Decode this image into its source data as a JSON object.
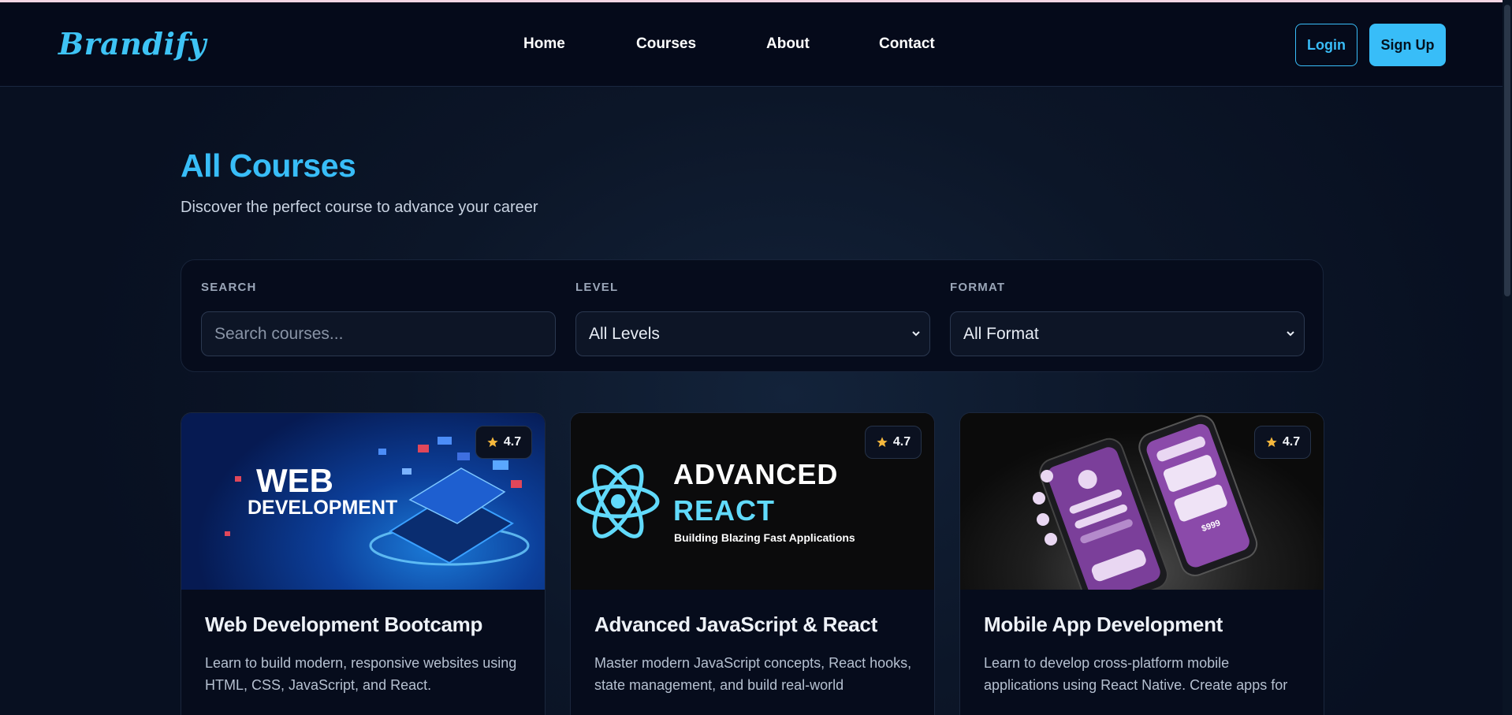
{
  "brand": {
    "logo_text": "Brandify",
    "accent": "#38bdf8"
  },
  "nav": {
    "items": [
      "Home",
      "Courses",
      "About",
      "Contact"
    ]
  },
  "auth": {
    "login_label": "Login",
    "signup_label": "Sign Up"
  },
  "page": {
    "title": "All Courses",
    "subtitle": "Discover the perfect course to advance your career"
  },
  "filters": {
    "search": {
      "label": "SEARCH",
      "placeholder": "Search courses...",
      "value": ""
    },
    "level": {
      "label": "LEVEL",
      "selected": "All Levels"
    },
    "format": {
      "label": "FORMAT",
      "selected": "All Format"
    }
  },
  "courses": [
    {
      "title": "Web Development Bootcamp",
      "description": "Learn to build modern, responsive websites using HTML, CSS, JavaScript, and React.",
      "rating": "4.7",
      "thumb": {
        "line1": "WEB",
        "line2": "DEVELOPMENT"
      }
    },
    {
      "title": "Advanced JavaScript & React",
      "description": "Master modern JavaScript concepts, React hooks, state management, and build real-world",
      "rating": "4.7",
      "thumb": {
        "line1": "ADVANCED",
        "line2": "REACT",
        "line3": "Building Blazing Fast Applications"
      }
    },
    {
      "title": "Mobile App Development",
      "description": "Learn to develop cross-platform mobile applications using React Native. Create apps for",
      "rating": "4.7",
      "thumb": {
        "price": "$999"
      }
    }
  ],
  "icons": {
    "rating": "star-icon",
    "select": "chevron-down-icon"
  },
  "colors": {
    "star": "#f5b83d",
    "mobile_ui": "#7b3f9a"
  }
}
